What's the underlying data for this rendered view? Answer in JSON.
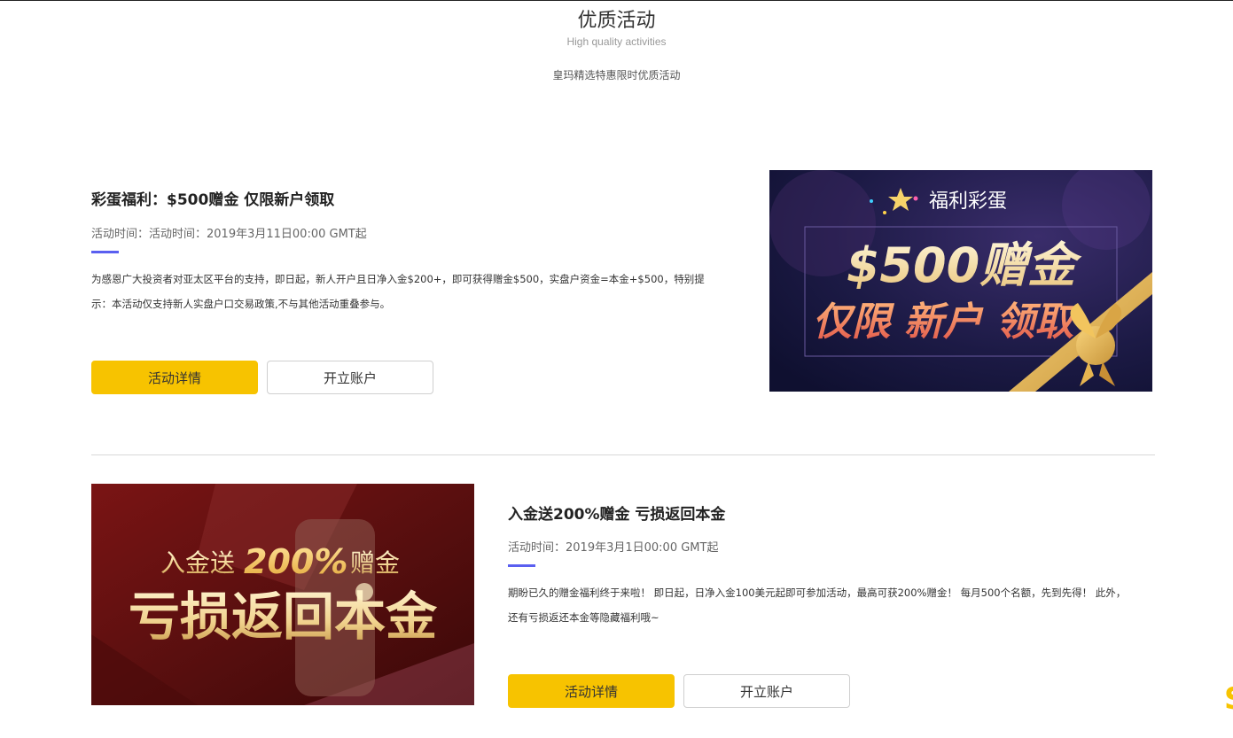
{
  "header": {
    "title": "优质活动",
    "subtitle": "High quality activities",
    "description": "皇玛精选特惠限时优质活动"
  },
  "promotions": [
    {
      "title": "彩蛋福利：$500赠金 仅限新户领取",
      "time": "活动时间：活动时间：2019年3月11日00:00 GMT起",
      "body_line1": "为感恩广大投资者对亚太区平台的支持，即日起，新人开户且日净入金$200+，即可获得赠金$500，实盘户资金=本金+$500，特别提",
      "body_line2": "示：本活动仅支持新人实盘户口交易政策,不与其他活动重叠参与。",
      "details_label": "活动详情",
      "open_account_label": "开立账户",
      "banner": {
        "tag": "福利彩蛋",
        "headline": "$500赠金",
        "subline": "仅限 新户 领取"
      }
    },
    {
      "title": "入金送200%赠金 亏损返回本金",
      "time": "活动时间：2019年3月1日00:00 GMT起",
      "body_line1": "期盼已久的赠金福利终于来啦！ 即日起，日净入金100美元起即可参加活动，最高可获200%赠金！ 每月500个名额，先到先得！ 此外，",
      "body_line2": "还有亏损返还本金等隐藏福利哦~",
      "details_label": "活动详情",
      "open_account_label": "开立账户",
      "banner": {
        "line1_prefix": "入金送",
        "line1_highlight": "200%",
        "line1_suffix": "赠金",
        "headline": "亏损返回本金"
      }
    }
  ],
  "colors": {
    "accent": "#f7c300",
    "bar": "#5a5ff0"
  }
}
